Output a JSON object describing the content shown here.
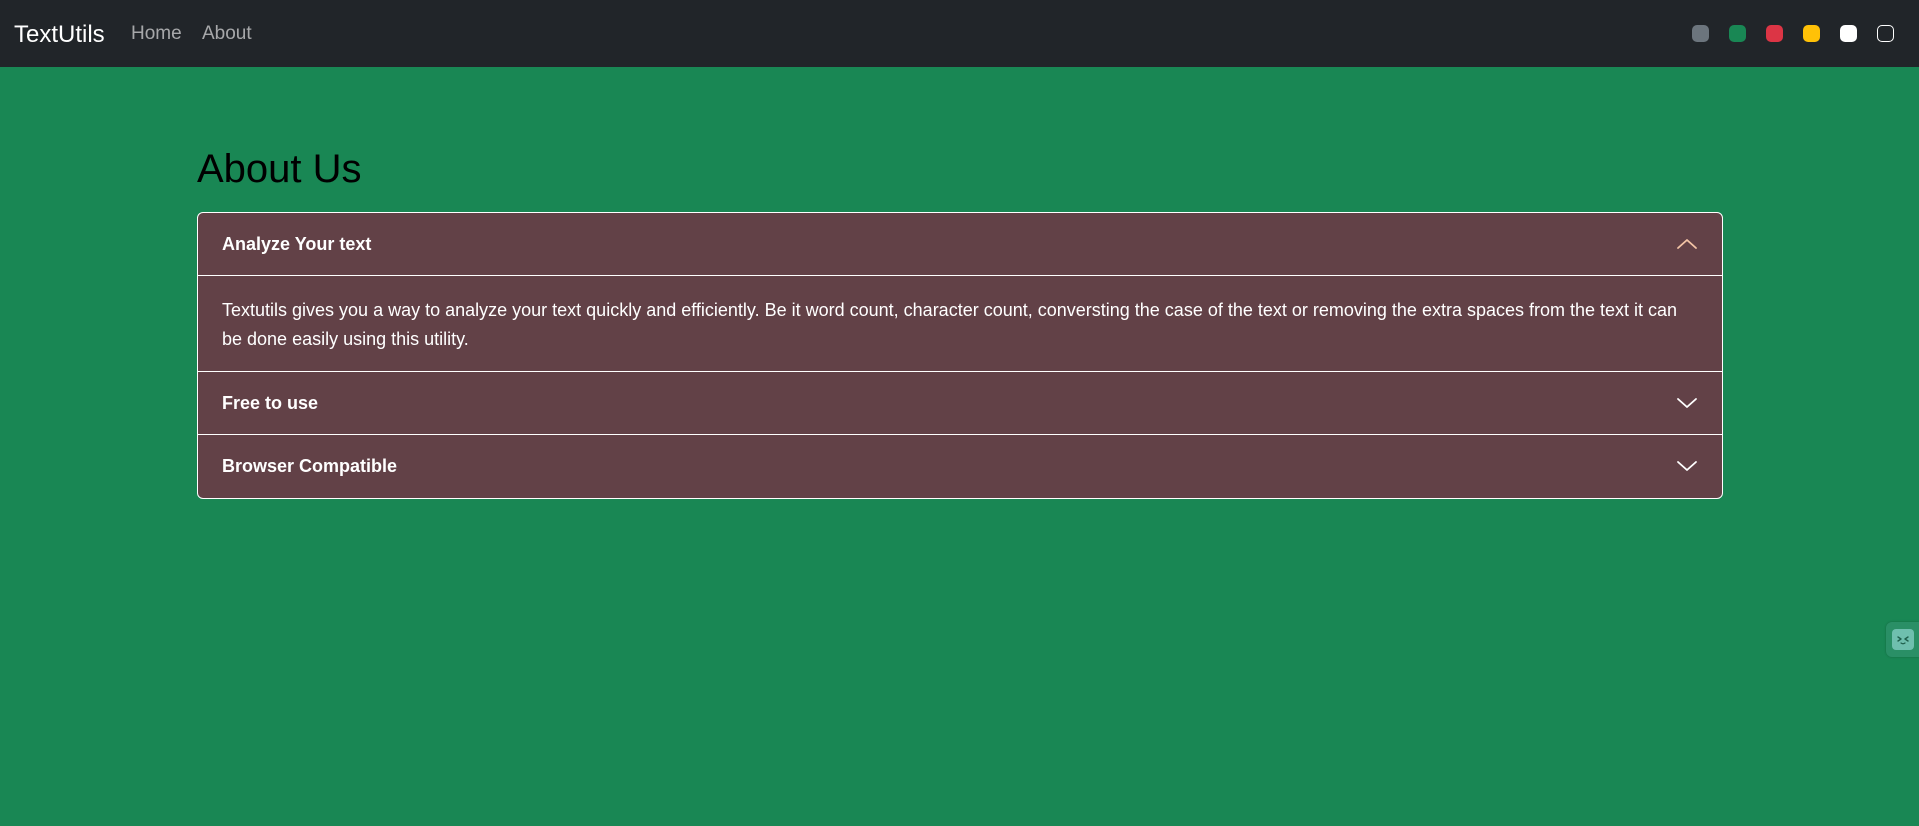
{
  "navbar": {
    "brand": "TextUtils",
    "links": [
      {
        "label": "Home"
      },
      {
        "label": "About"
      }
    ],
    "theme_swatches": [
      {
        "name": "secondary",
        "color": "#6c757d"
      },
      {
        "name": "success",
        "color": "#198754"
      },
      {
        "name": "danger",
        "color": "#dc3545"
      },
      {
        "name": "warning",
        "color": "#ffc107"
      },
      {
        "name": "light",
        "color": "#ffffff"
      },
      {
        "name": "dark",
        "color": "#212529"
      }
    ]
  },
  "main": {
    "title": "About Us",
    "accordion": [
      {
        "title": "Analyze Your text",
        "expanded": true,
        "body": "Textutils gives you a way to analyze your text quickly and efficiently. Be it word count, character count, conversting the case of the text or removing the extra spaces from the text it can be done easily using this utility."
      },
      {
        "title": "Free to use",
        "expanded": false
      },
      {
        "title": "Browser Compatible",
        "expanded": false
      }
    ]
  },
  "colors": {
    "page_background": "#198754",
    "navbar_background": "#212529",
    "accordion_background": "#624147",
    "active_chevron": "#f3c4a6"
  },
  "icons": {
    "expanded_chevron": "chevron-up-icon",
    "collapsed_chevron": "chevron-down-icon",
    "side_widget": "assistant-face-icon"
  }
}
